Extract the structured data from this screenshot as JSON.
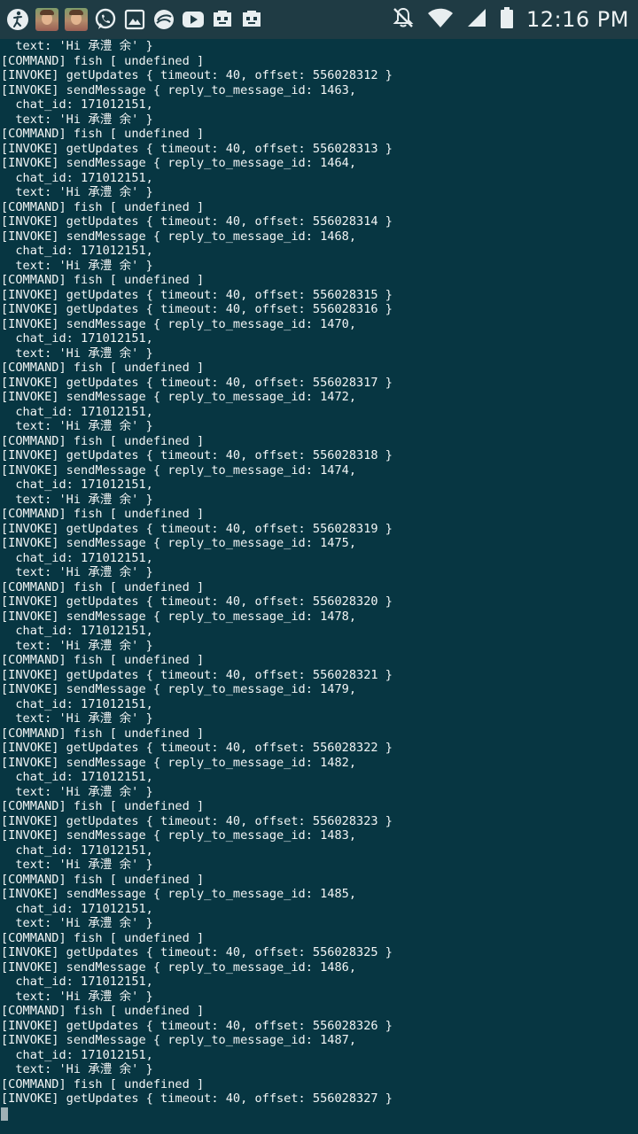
{
  "status_bar": {
    "time": "12:16 PM",
    "notification_icons": [
      "accessibility-icon",
      "contact-avatar-icon",
      "contact-avatar-icon",
      "whatsapp-icon",
      "gallery-icon",
      "browser-icon",
      "youtube-icon",
      "game-app-icon",
      "game-app-icon"
    ],
    "system_icons": [
      "mute-icon",
      "wifi-icon",
      "signal-icon",
      "battery-icon"
    ]
  },
  "terminal": {
    "lines": [
      "  text: 'Hi 承澧 余' }",
      "[COMMAND] fish [ undefined ]",
      "[INVOKE] getUpdates { timeout: 40, offset: 556028312 }",
      "[INVOKE] sendMessage { reply_to_message_id: 1463,",
      "  chat_id: 171012151,",
      "  text: 'Hi 承澧 余' }",
      "[COMMAND] fish [ undefined ]",
      "[INVOKE] getUpdates { timeout: 40, offset: 556028313 }",
      "[INVOKE] sendMessage { reply_to_message_id: 1464,",
      "  chat_id: 171012151,",
      "  text: 'Hi 承澧 余' }",
      "[COMMAND] fish [ undefined ]",
      "[INVOKE] getUpdates { timeout: 40, offset: 556028314 }",
      "[INVOKE] sendMessage { reply_to_message_id: 1468,",
      "  chat_id: 171012151,",
      "  text: 'Hi 承澧 余' }",
      "[COMMAND] fish [ undefined ]",
      "[INVOKE] getUpdates { timeout: 40, offset: 556028315 }",
      "[INVOKE] getUpdates { timeout: 40, offset: 556028316 }",
      "[INVOKE] sendMessage { reply_to_message_id: 1470,",
      "  chat_id: 171012151,",
      "  text: 'Hi 承澧 余' }",
      "[COMMAND] fish [ undefined ]",
      "[INVOKE] getUpdates { timeout: 40, offset: 556028317 }",
      "[INVOKE] sendMessage { reply_to_message_id: 1472,",
      "  chat_id: 171012151,",
      "  text: 'Hi 承澧 余' }",
      "[COMMAND] fish [ undefined ]",
      "[INVOKE] getUpdates { timeout: 40, offset: 556028318 }",
      "[INVOKE] sendMessage { reply_to_message_id: 1474,",
      "  chat_id: 171012151,",
      "  text: 'Hi 承澧 余' }",
      "[COMMAND] fish [ undefined ]",
      "[INVOKE] getUpdates { timeout: 40, offset: 556028319 }",
      "[INVOKE] sendMessage { reply_to_message_id: 1475,",
      "  chat_id: 171012151,",
      "  text: 'Hi 承澧 余' }",
      "[COMMAND] fish [ undefined ]",
      "[INVOKE] getUpdates { timeout: 40, offset: 556028320 }",
      "[INVOKE] sendMessage { reply_to_message_id: 1478,",
      "  chat_id: 171012151,",
      "  text: 'Hi 承澧 余' }",
      "[COMMAND] fish [ undefined ]",
      "[INVOKE] getUpdates { timeout: 40, offset: 556028321 }",
      "[INVOKE] sendMessage { reply_to_message_id: 1479,",
      "  chat_id: 171012151,",
      "  text: 'Hi 承澧 余' }",
      "[COMMAND] fish [ undefined ]",
      "[INVOKE] getUpdates { timeout: 40, offset: 556028322 }",
      "[INVOKE] sendMessage { reply_to_message_id: 1482,",
      "  chat_id: 171012151,",
      "  text: 'Hi 承澧 余' }",
      "[COMMAND] fish [ undefined ]",
      "[INVOKE] getUpdates { timeout: 40, offset: 556028323 }",
      "[INVOKE] sendMessage { reply_to_message_id: 1483,",
      "  chat_id: 171012151,",
      "  text: 'Hi 承澧 余' }",
      "[COMMAND] fish [ undefined ]",
      "[INVOKE] sendMessage { reply_to_message_id: 1485,",
      "  chat_id: 171012151,",
      "  text: 'Hi 承澧 余' }",
      "[COMMAND] fish [ undefined ]",
      "[INVOKE] getUpdates { timeout: 40, offset: 556028325 }",
      "[INVOKE] sendMessage { reply_to_message_id: 1486,",
      "  chat_id: 171012151,",
      "  text: 'Hi 承澧 余' }",
      "[COMMAND] fish [ undefined ]",
      "[INVOKE] getUpdates { timeout: 40, offset: 556028326 }",
      "[INVOKE] sendMessage { reply_to_message_id: 1487,",
      "  chat_id: 171012151,",
      "  text: 'Hi 承澧 余' }",
      "[COMMAND] fish [ undefined ]",
      "[INVOKE] getUpdates { timeout: 40, offset: 556028327 }"
    ]
  },
  "colors": {
    "terminal_background": "#073642",
    "terminal_text": "#f2f5f5",
    "status_bar_background": "#1f3b44",
    "cursor": "#9fb1b5"
  }
}
